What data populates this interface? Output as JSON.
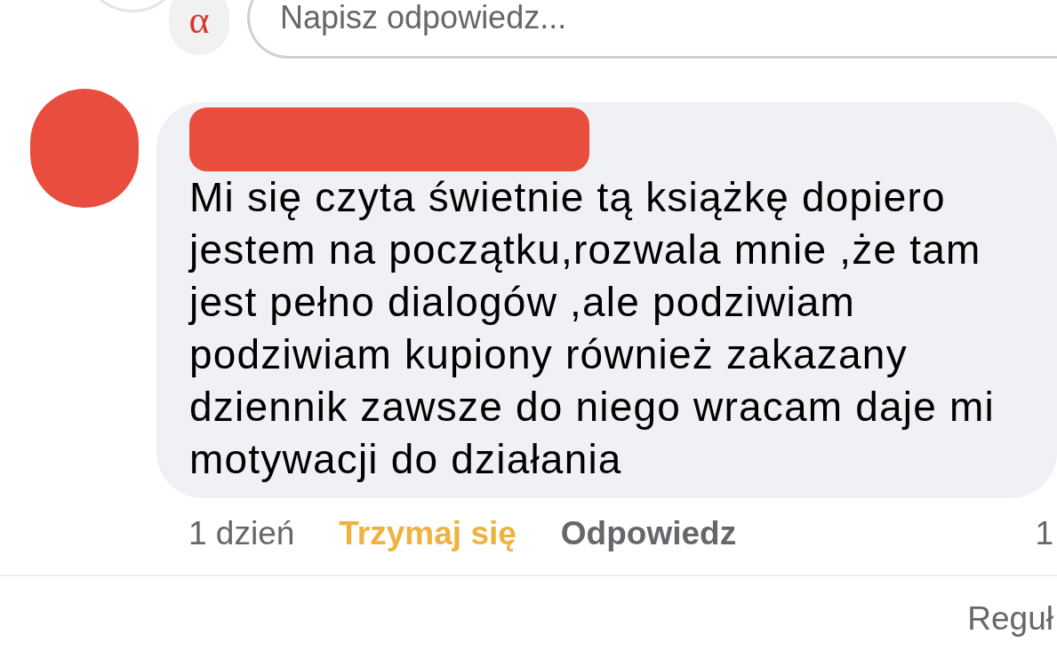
{
  "reply_box": {
    "avatar_glyph": "α",
    "placeholder": "Napisz odpowiedz..."
  },
  "comment": {
    "text": "Mi się czyta świetnie tą książkę dopiero jestem na początku,rozwala mnie ,że tam jest pełno dialogów ,ale podziwiam podziwiam kupiony również zakazany dziennik zawsze do niego wracam daje mi motywacji do działania",
    "time": "1 dzień",
    "reaction": "Trzymaj się",
    "reacted": true,
    "reply": "Odpowiedz",
    "reaction_count": "1"
  },
  "footer": {
    "link": "Reguł"
  }
}
